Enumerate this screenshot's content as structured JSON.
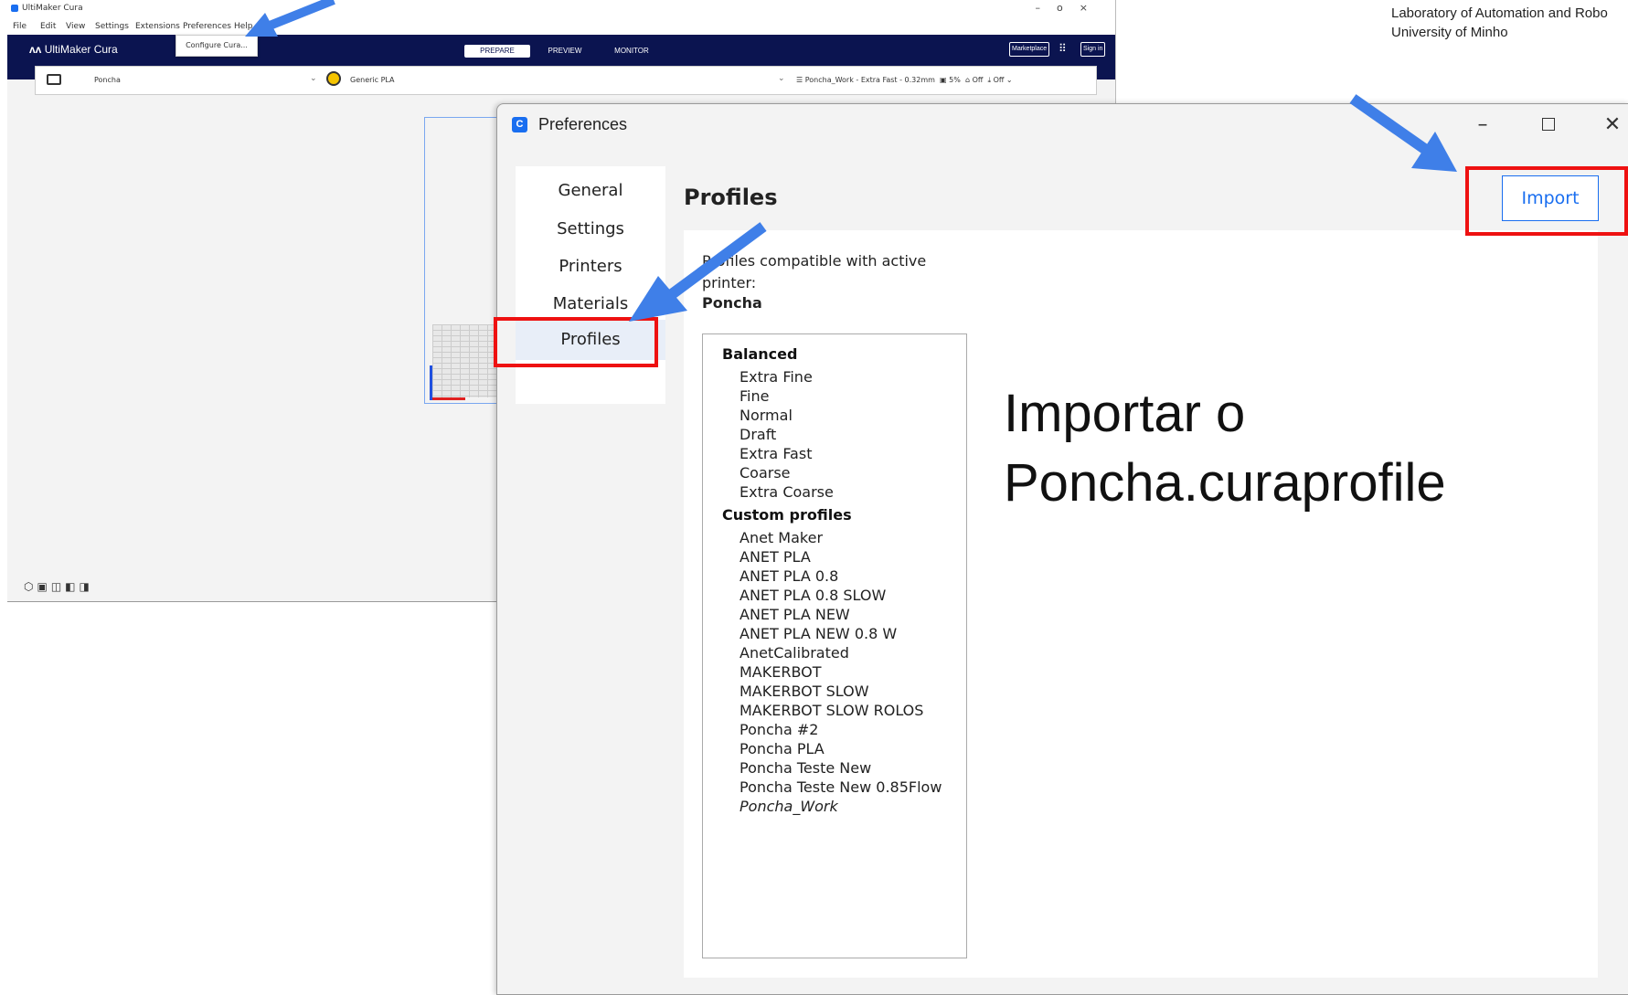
{
  "credit": {
    "line1": "Laboratory of Automation and Robo",
    "line2": "University of Minho"
  },
  "cura": {
    "window_title": "UltiMaker Cura",
    "menu": [
      "File",
      "Edit",
      "View",
      "Settings",
      "Extensions",
      "Preferences",
      "Help"
    ],
    "dropdown_item": "Configure Cura...",
    "logo": "UltiMaker Cura",
    "stages": [
      "PREPARE",
      "PREVIEW",
      "MONITOR"
    ],
    "marketplace": "Marketplace",
    "sign_in": "Sign in",
    "printer": "Poncha",
    "material": "Generic PLA",
    "print_settings": "Poncha_Work - Extra Fast - 0.32mm",
    "infill": "5%",
    "support": "Off",
    "adhesion": "Off",
    "icons": [
      "folder-icon",
      "material-icon",
      "settings-sliders-icon",
      "grid-apps-icon",
      "view-3d-icon"
    ]
  },
  "preferences": {
    "title": "Preferences",
    "nav": [
      "General",
      "Settings",
      "Printers",
      "Materials",
      "Profiles"
    ],
    "active_nav": "Profiles",
    "heading": "Profiles",
    "import_label": "Import",
    "compat_text": "Profiles compatible with active printer:",
    "compat_printer": "Poncha",
    "groups": [
      {
        "name": "Balanced",
        "items": [
          "Extra Fine",
          "Fine",
          "Normal",
          "Draft",
          "Extra Fast",
          "Coarse",
          "Extra Coarse"
        ]
      },
      {
        "name": "Custom profiles",
        "items": [
          "Anet Maker",
          "ANET PLA",
          "ANET PLA 0.8",
          "ANET PLA 0.8 SLOW",
          "ANET PLA NEW",
          "ANET PLA NEW 0.8 W",
          "AnetCalibrated",
          "MAKERBOT",
          "MAKERBOT SLOW",
          "MAKERBOT SLOW ROLOS",
          "Poncha #2",
          "Poncha PLA",
          "Poncha Teste New",
          "Poncha Teste New 0.85Flow",
          "Poncha_Work"
        ]
      }
    ]
  },
  "annotation": {
    "line1": "Importar o",
    "line2": "Poncha.curaprofile"
  },
  "colors": {
    "cura_header": "#0b1450",
    "accent_blue": "#196ef0",
    "highlight_red": "#ee1111",
    "arrow_blue": "#3f7fe8"
  }
}
